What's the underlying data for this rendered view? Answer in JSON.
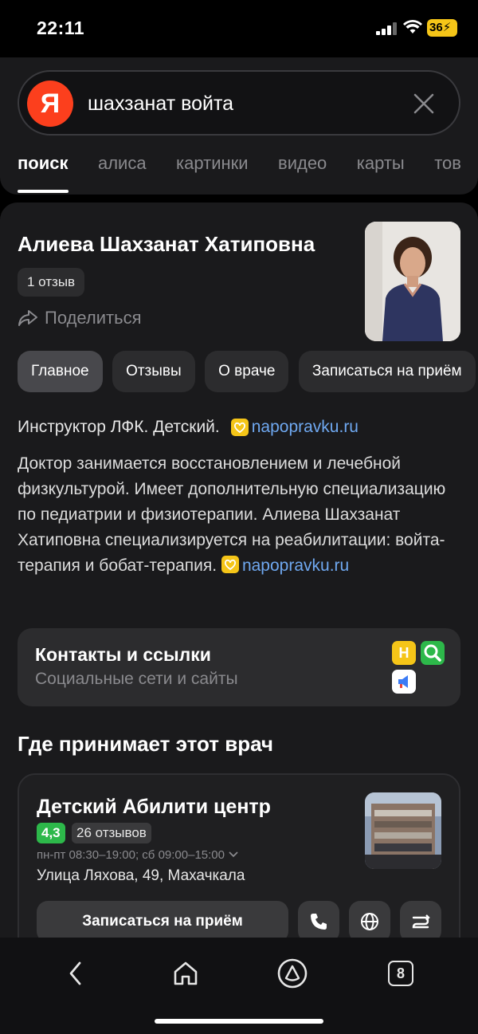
{
  "status_bar": {
    "time": "22:11",
    "battery": "36"
  },
  "search": {
    "logo": "Я",
    "query": "шахзанат войта"
  },
  "tabs": [
    {
      "label": "поиск"
    },
    {
      "label": "алиса"
    },
    {
      "label": "картинки"
    },
    {
      "label": "видео"
    },
    {
      "label": "карты"
    },
    {
      "label": "тов"
    }
  ],
  "doctor": {
    "name": "Алиева Шахзанат Хатиповна",
    "reviews": "1 отзыв",
    "share_label": "Поделиться",
    "pills": [
      "Главное",
      "Отзывы",
      "О враче",
      "Записаться на приём"
    ],
    "specialty": "Инструктор ЛФК. Детский.",
    "source": "napopravku.ru",
    "description": "Доктор занимается восстановлением и лечебной физкультурой. Имеет дополнительную специализацию по педиатрии и физиотерапии. Алиева Шахзанат Хатиповна специализируется на реабилитации: войта-терапия и бобат-терапия."
  },
  "contacts": {
    "title": "Контакты и ссылки",
    "subtitle": "Социальные сети и сайты",
    "icon_letter": "Н"
  },
  "where": {
    "title": "Где принимает этот врач",
    "clinic": {
      "name": "Детский Абилити центр",
      "rating": "4,3",
      "reviews": "26 отзывов",
      "hours": "пн-пт 08:30–19:00; сб 09:00–15:00",
      "address": "Улица Ляхова, 49, Махачкала",
      "book_label": "Записаться на приём"
    }
  },
  "bottom_nav": {
    "tabs_count": "8"
  },
  "colors": {
    "accent": "#fc3f1d",
    "link": "#6fa8f0",
    "rating": "#2db84a",
    "badge": "#f5c518"
  }
}
